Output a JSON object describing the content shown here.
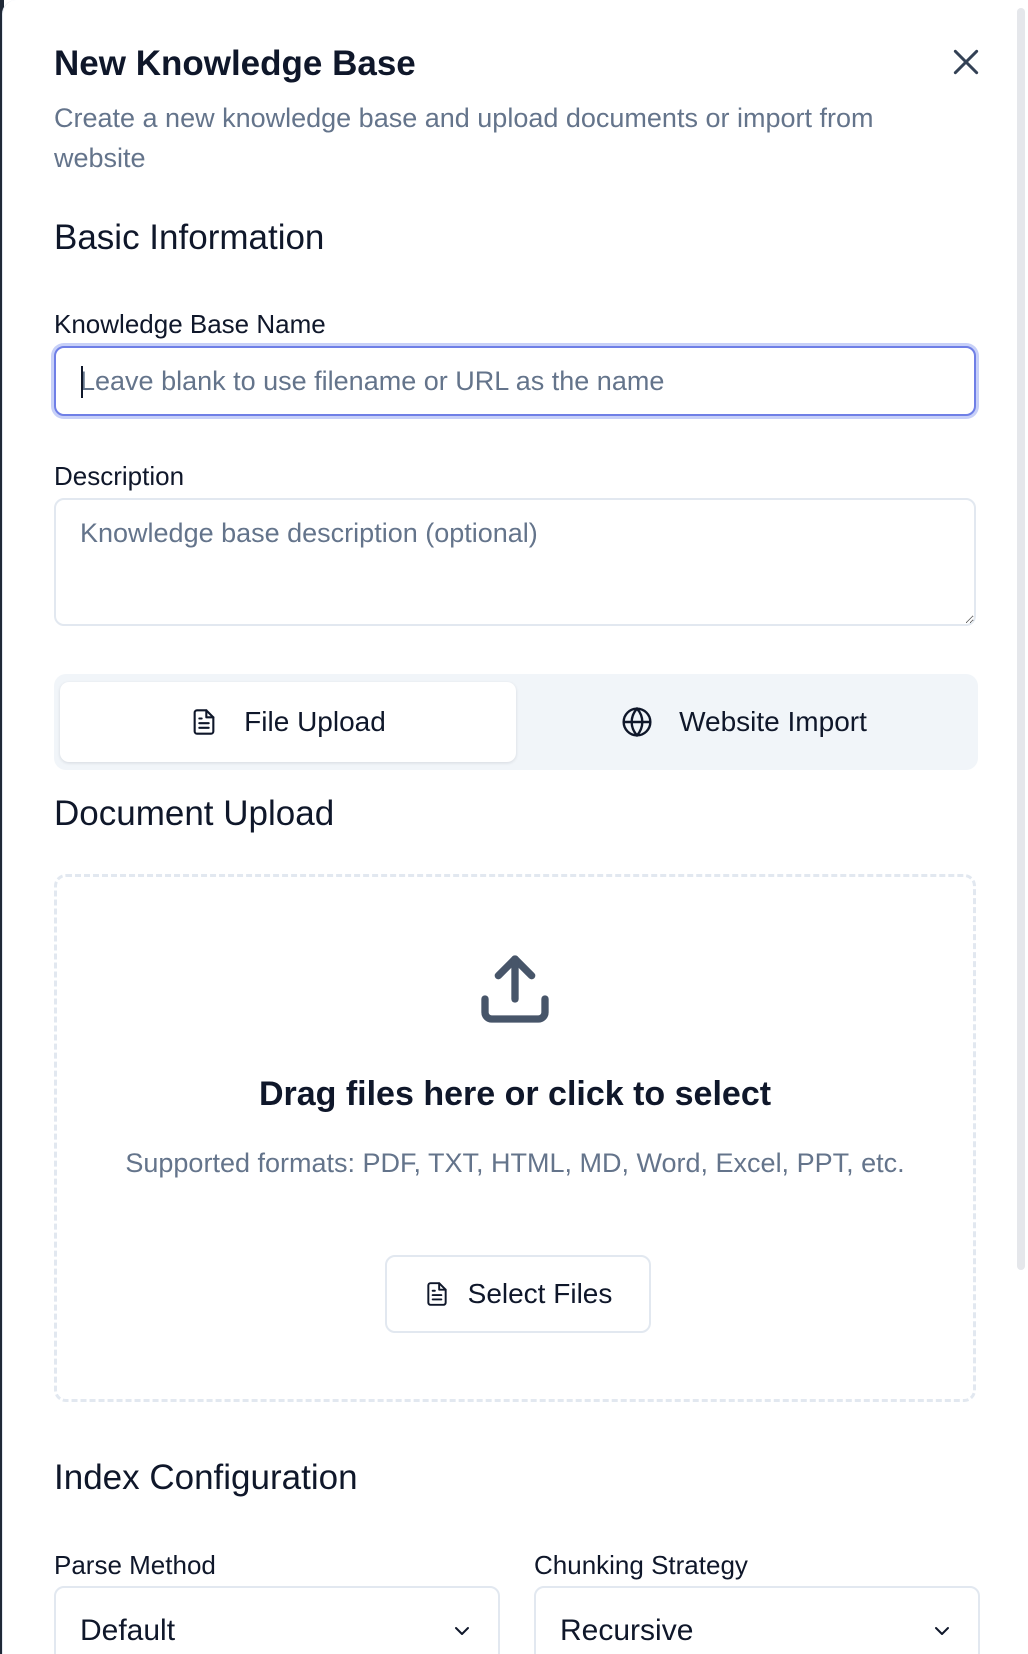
{
  "dialog": {
    "title": "New Knowledge Base",
    "subtitle": "Create a new knowledge base and upload documents or import from website",
    "close_icon": "close-icon"
  },
  "basic_info": {
    "heading": "Basic Information",
    "name_label": "Knowledge Base Name",
    "name_value": "",
    "name_placeholder": "Leave blank to use filename or URL as the name",
    "description_label": "Description",
    "description_value": "",
    "description_placeholder": "Knowledge base description (optional)"
  },
  "tabs": [
    {
      "label": "File Upload",
      "icon": "file-icon",
      "active": true
    },
    {
      "label": "Website Import",
      "icon": "globe-icon",
      "active": false
    }
  ],
  "document_upload": {
    "heading": "Document Upload",
    "icon": "upload-icon",
    "drop_title": "Drag files here or click to select",
    "formats": "Supported formats: PDF, TXT, HTML, MD, Word, Excel, PPT, etc.",
    "select_button": "Select Files"
  },
  "index_config": {
    "heading": "Index Configuration",
    "parse_label": "Parse Method",
    "parse_value": "Default",
    "chunk_label": "Chunking Strategy",
    "chunk_value": "Recursive"
  },
  "colors": {
    "focus_ring": "#6f7fe6",
    "muted_text": "#64748b",
    "tab_background": "#f1f5f9",
    "border": "#e2e8f0"
  }
}
